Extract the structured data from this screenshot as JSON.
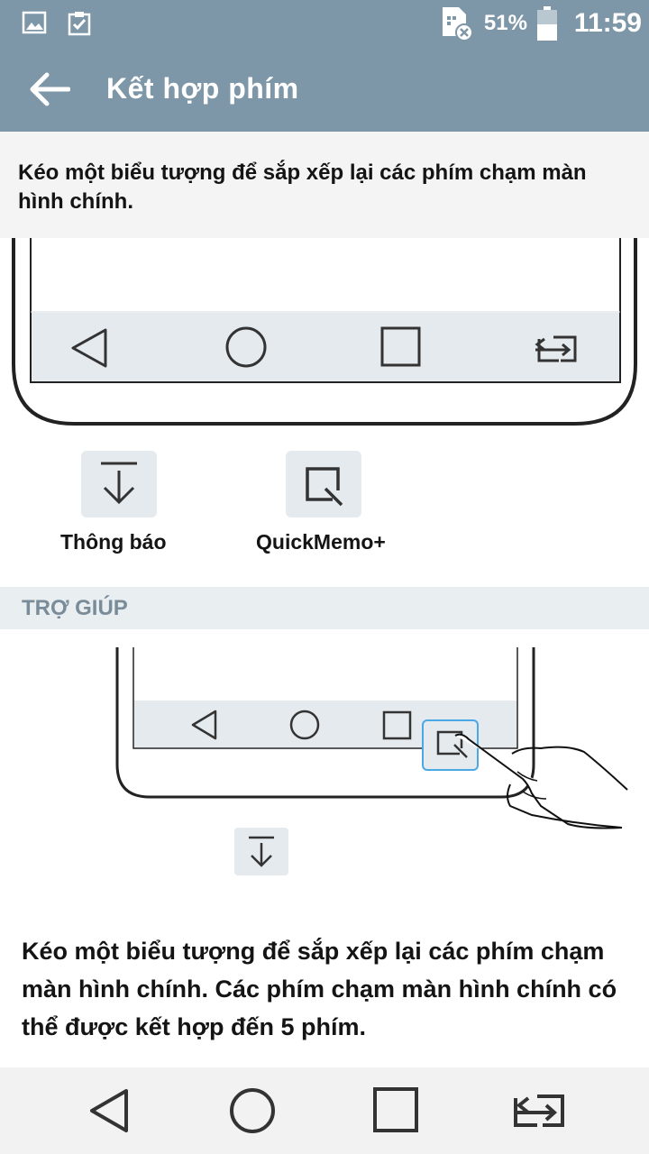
{
  "status_bar": {
    "battery_percent": "51%",
    "time": "11:59",
    "left_icons": [
      "image-icon",
      "clipboard-check-icon"
    ],
    "right_icons": [
      "sim-error-icon",
      "battery-icon"
    ]
  },
  "app_bar": {
    "title": "Kết hợp phím",
    "back_icon": "arrow-left-icon"
  },
  "description": "Kéo một biểu tượng để sắp xếp lại các phím chạm màn hình chính.",
  "available_keys": [
    {
      "label": "Thông báo",
      "icon": "notification-download-icon"
    },
    {
      "label": "QuickMemo+",
      "icon": "quickmemo-icon"
    }
  ],
  "help": {
    "header": "TRỢ GIÚP",
    "text": "Kéo một biểu tượng để sắp xếp lại các phím chạm màn hình chính. Các phím chạm màn hình chính có thể được kết hợp đến 5 phím."
  },
  "colors": {
    "app_bar": "#7d97a8",
    "tile_bg": "#e5eaee",
    "help_header_text": "#7a8c99",
    "highlight_border": "#4aa8e6"
  }
}
